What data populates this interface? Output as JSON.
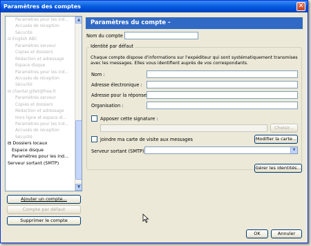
{
  "window": {
    "title": "Paramètres des comptes"
  },
  "tree": {
    "items": [
      {
        "label": "Paramètres pour les ind...",
        "level": "l2",
        "sharp": false
      },
      {
        "label": "Accusés de réception",
        "level": "l2",
        "sharp": false
      },
      {
        "label": "Sécurité",
        "level": "l2",
        "sharp": false
      },
      {
        "label": "⊟ English ABC",
        "level": "l1",
        "sharp": false
      },
      {
        "label": "Paramètres serveur",
        "level": "l2",
        "sharp": false
      },
      {
        "label": "Copies et dossiers",
        "level": "l2",
        "sharp": false
      },
      {
        "label": "Rédaction et adressage",
        "level": "l2",
        "sharp": false
      },
      {
        "label": "Espace disque",
        "level": "l2",
        "sharp": false
      },
      {
        "label": "Paramètres pour les ind...",
        "level": "l2",
        "sharp": false
      },
      {
        "label": "Accusés de réception",
        "level": "l2",
        "sharp": false
      },
      {
        "label": "Sécurité",
        "level": "l2",
        "sharp": false
      },
      {
        "label": "⊟ chantal.gillet@free.fr",
        "level": "l1",
        "sharp": false
      },
      {
        "label": "Paramètres serveur",
        "level": "l2",
        "sharp": false
      },
      {
        "label": "Copies et dossiers",
        "level": "l2",
        "sharp": false
      },
      {
        "label": "Rédaction et adressage",
        "level": "l2",
        "sharp": false
      },
      {
        "label": "Hors ligne et espace di...",
        "level": "l2",
        "sharp": false
      },
      {
        "label": "Paramètres pour les ind...",
        "level": "l2",
        "sharp": false
      },
      {
        "label": "Accusés de réception",
        "level": "l2",
        "sharp": false
      },
      {
        "label": "Sécurité",
        "level": "l2",
        "sharp": false
      },
      {
        "label": "⊟ Dossiers locaux",
        "level": "l1",
        "sharp": true
      },
      {
        "label": "Espace disque",
        "level": "l2s",
        "sharp": true
      },
      {
        "label": "Paramètres pour les ind...",
        "level": "l2s",
        "sharp": true
      },
      {
        "label": "Serveur sortant (SMTP)",
        "level": "l1",
        "sharp": true
      }
    ]
  },
  "buttons": {
    "add_account": "Ajouter un compte...",
    "default_account": "Compte par défaut",
    "delete_account": "Supprimer le compte",
    "choose": "Choisir...",
    "edit_card": "Modifier la carte...",
    "manage_identities": "Gérer les identités...",
    "ok": "OK",
    "cancel": "Annuler"
  },
  "panel": {
    "header": "Paramètres du compte -",
    "account_name_label": "Nom du compte :",
    "account_name_value": "",
    "identity_group": "Identité par défaut",
    "identity_desc": "Chaque compte dispose d'informations sur l'expéditeur qui sont systématiquement transmises avec les messages. Elles vous identifient auprès de vos correspondants.",
    "name_label": "Nom :",
    "email_label": "Adresse électronique :",
    "reply_label": "Adresse pour la réponse :",
    "org_label": "Organisation :",
    "signature_label": "Apposer cette signature :",
    "vcard_label": "Joindre ma carte de visite aux messages",
    "smtp_label": "Serveur sortant (SMTP):",
    "smtp_value": ""
  },
  "colors": {
    "titlebar": "#0a5fe0",
    "header_bar": "#316ac5",
    "window_bg": "#ece9d8"
  }
}
